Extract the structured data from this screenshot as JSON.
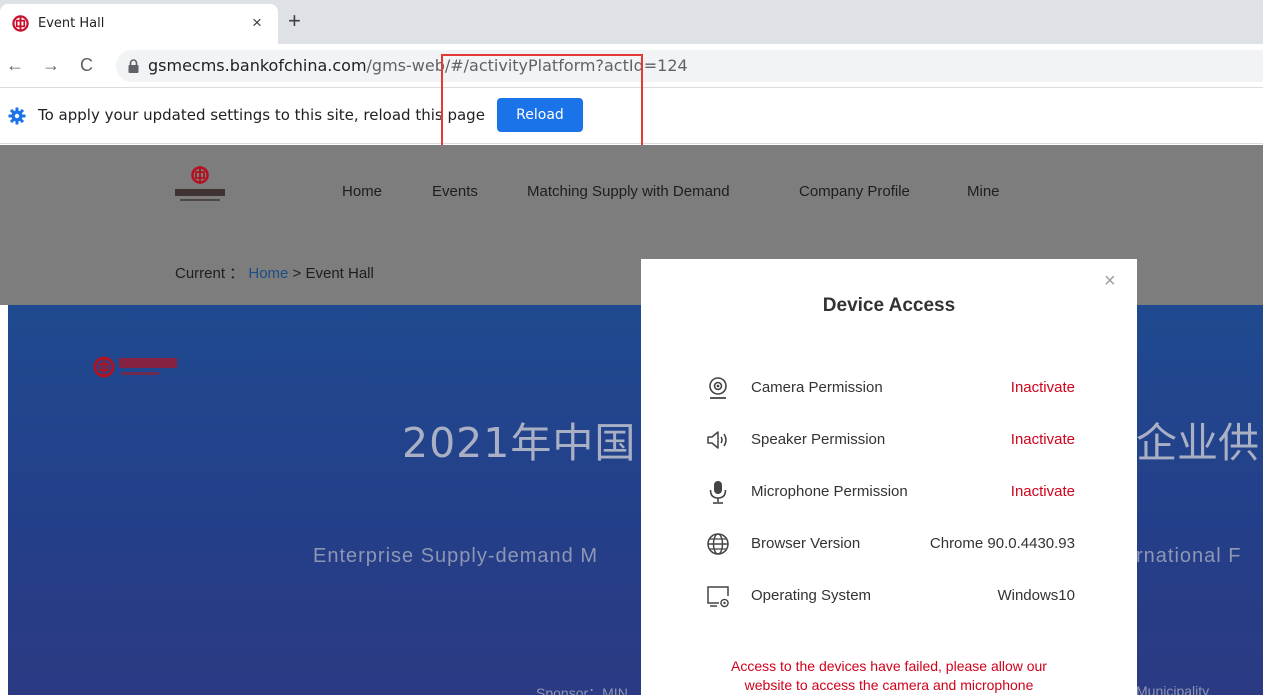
{
  "browser": {
    "tab_title": "Event Hall",
    "tab_close": "×",
    "new_tab": "+",
    "back": "←",
    "forward": "→",
    "refresh": "C",
    "url_host": "gsmecms.bankofchina.com",
    "url_path": "/gms-web/#/activityPlatform?actId=124",
    "infobar_text": "To apply your updated settings to this site, reload this page",
    "reload_label": "Reload",
    "colors": {
      "highlight": "#e53935",
      "reload": "#1a73e8"
    }
  },
  "header": {
    "nav": [
      "Home",
      "Events",
      "Matching Supply with Demand",
      "Company Profile",
      "Mine"
    ],
    "breadcrumb_prefix": "Current ：",
    "breadcrumb_home": "Home",
    "breadcrumb_sep": ">",
    "breadcrumb_current": "Event Hall"
  },
  "banner": {
    "title_left": "2021年中国",
    "title_right": "企业供",
    "subtitle_left": "Enterprise Supply-demand M",
    "subtitle_right": "rnational F",
    "sponsor_left": "Sponsor：MIN",
    "sponsor_right": "Municipality"
  },
  "modal": {
    "title": "Device Access",
    "close": "×",
    "rows": [
      {
        "icon": "camera-icon",
        "label": "Camera Permission",
        "value": "Inactivate",
        "status": "error"
      },
      {
        "icon": "speaker-icon",
        "label": "Speaker Permission",
        "value": "Inactivate",
        "status": "error"
      },
      {
        "icon": "microphone-icon",
        "label": "Microphone Permission",
        "value": "Inactivate",
        "status": "error"
      },
      {
        "icon": "globe-icon",
        "label": "Browser Version",
        "value": "Chrome 90.0.4430.93",
        "status": "ok"
      },
      {
        "icon": "monitor-icon",
        "label": "Operating System",
        "value": "Windows10",
        "status": "ok"
      }
    ],
    "error_line1": "Access to the devices have failed, please allow our",
    "error_line2": "website to access the camera and microphone"
  }
}
